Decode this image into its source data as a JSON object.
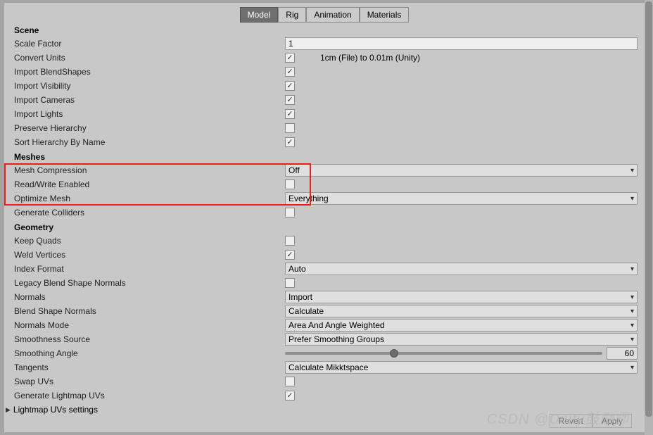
{
  "tabs": [
    "Model",
    "Rig",
    "Animation",
    "Materials"
  ],
  "activeTab": 0,
  "sections": {
    "scene": {
      "header": "Scene",
      "scaleFactor": {
        "label": "Scale Factor",
        "value": "1"
      },
      "convertUnits": {
        "label": "Convert Units",
        "checked": true,
        "hint": "1cm (File) to 0.01m (Unity)"
      },
      "importBlendShapes": {
        "label": "Import BlendShapes",
        "checked": true
      },
      "importVisibility": {
        "label": "Import Visibility",
        "checked": true
      },
      "importCameras": {
        "label": "Import Cameras",
        "checked": true
      },
      "importLights": {
        "label": "Import Lights",
        "checked": true
      },
      "preserveHierarchy": {
        "label": "Preserve Hierarchy",
        "checked": false
      },
      "sortHierarchyByName": {
        "label": "Sort Hierarchy By Name",
        "checked": true
      }
    },
    "meshes": {
      "header": "Meshes",
      "meshCompression": {
        "label": "Mesh Compression",
        "value": "Off"
      },
      "readWriteEnabled": {
        "label": "Read/Write Enabled",
        "checked": false
      },
      "optimizeMesh": {
        "label": "Optimize Mesh",
        "value": "Everything"
      },
      "generateColliders": {
        "label": "Generate Colliders",
        "checked": false
      }
    },
    "geometry": {
      "header": "Geometry",
      "keepQuads": {
        "label": "Keep Quads",
        "checked": false
      },
      "weldVertices": {
        "label": "Weld Vertices",
        "checked": true
      },
      "indexFormat": {
        "label": "Index Format",
        "value": "Auto"
      },
      "legacyBlendShapeNormals": {
        "label": "Legacy Blend Shape Normals",
        "checked": false
      },
      "normals": {
        "label": "Normals",
        "value": "Import"
      },
      "blendShapeNormals": {
        "label": "Blend Shape Normals",
        "value": "Calculate"
      },
      "normalsMode": {
        "label": "Normals Mode",
        "value": "Area And Angle Weighted"
      },
      "smoothnessSource": {
        "label": "Smoothness Source",
        "value": "Prefer Smoothing Groups"
      },
      "smoothingAngle": {
        "label": "Smoothing Angle",
        "value": "60",
        "percent": 33
      },
      "tangents": {
        "label": "Tangents",
        "value": "Calculate Mikktspace"
      },
      "swapUVs": {
        "label": "Swap UVs",
        "checked": false
      },
      "generateLightmapUVs": {
        "label": "Generate Lightmap UVs",
        "checked": true
      },
      "lightmapUVsSettings": {
        "label": "Lightmap UVs settings"
      }
    }
  },
  "buttons": {
    "revert": "Revert",
    "apply": "Apply"
  },
  "watermark": "CSDN @Unity鼓励师"
}
